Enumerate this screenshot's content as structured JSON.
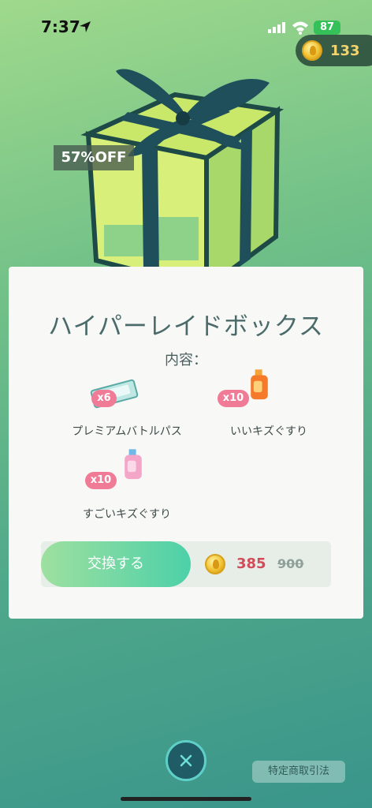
{
  "status_bar": {
    "time": "7:37",
    "battery": "87"
  },
  "wallet": {
    "coins": "133"
  },
  "offer": {
    "discount": "57%OFF"
  },
  "box": {
    "title": "ハイパーレイドボックス",
    "contents_label": "内容：",
    "items": [
      {
        "qty": "x6",
        "label": "プレミアムバトルパス",
        "icon": "premium-battle-pass-icon"
      },
      {
        "qty": "x10",
        "label": "いいキズぐすり",
        "icon": "super-potion-icon"
      },
      {
        "qty": "x10",
        "label": "すごいキズぐすり",
        "icon": "hyper-potion-icon"
      }
    ]
  },
  "purchase": {
    "button_label": "交換する",
    "price": "385",
    "original_price": "900"
  },
  "footer": {
    "legal_label": "特定商取引法"
  },
  "colors": {
    "accent": "#4dd0a8",
    "price": "#d24b5b",
    "badge": "#f07b97"
  }
}
